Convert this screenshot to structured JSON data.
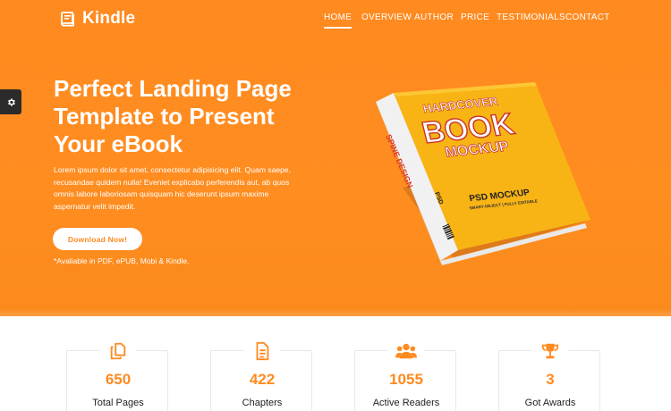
{
  "brand": {
    "name": "Kindle",
    "logo_icon": "book-icon",
    "accent": "#ff8a1f"
  },
  "nav": {
    "items": [
      {
        "label": "HOME",
        "active": true
      },
      {
        "label": "OVERVIEW"
      },
      {
        "label": "AUTHOR"
      },
      {
        "label": "PRICE"
      },
      {
        "label": "TESTIMONIALS"
      },
      {
        "label": "CONTACT"
      }
    ]
  },
  "settings": {
    "icon": "gear-icon"
  },
  "hero": {
    "title_lines": [
      "Perfect Landing Page",
      "Template to Present",
      "Your eBook"
    ],
    "description_lines": [
      "Lorem ipsum dolor sit amet, consectetur adipisicing elit. Quam saepe,",
      "recusandae quidem nulla! Eveniet explicabo perferendis aut, ab quos",
      "omnis labore laboriosam quisquam hic deserunt ipsum maxime",
      "aspernatur velit impedit."
    ],
    "cta_label": "Download Now!",
    "availability": "*Avaliable in PDF, ePUB, Mobi & Kindle."
  },
  "book": {
    "cover_line1": "HARDCOVER",
    "cover_line2": "BOOK",
    "cover_line3": "MOCKUP",
    "cover_sub1": "PSD MOCKUP",
    "cover_sub2": "SMART-OBJECT | FULLY EDITABLE",
    "spine_text": "SPINE DESIGN",
    "spine_sub": "PSD"
  },
  "stats": [
    {
      "icon": "copy-pages-icon",
      "value": "650",
      "label": "Total Pages"
    },
    {
      "icon": "document-icon",
      "value": "422",
      "label": "Chapters"
    },
    {
      "icon": "users-icon",
      "value": "1055",
      "label": "Active Readers"
    },
    {
      "icon": "trophy-icon",
      "value": "3",
      "label": "Got Awards"
    }
  ]
}
